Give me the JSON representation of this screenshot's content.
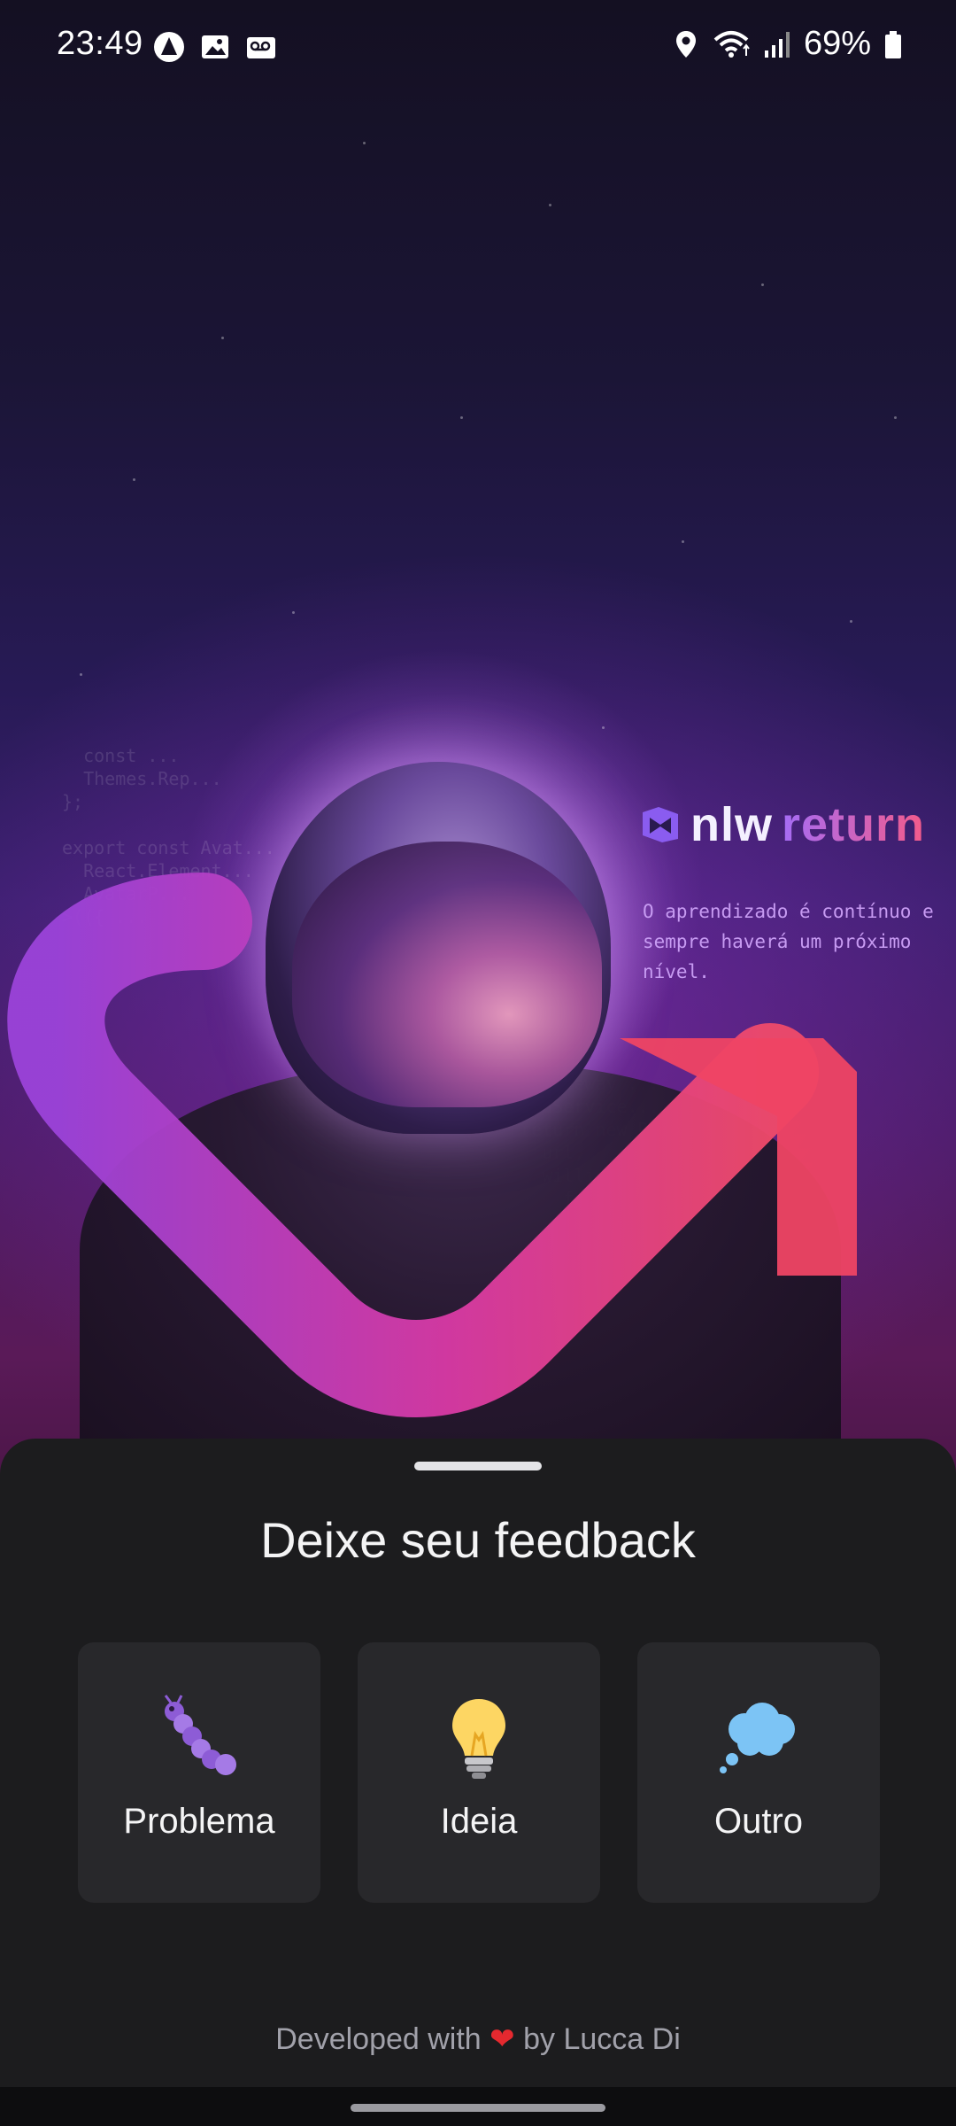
{
  "status_bar": {
    "time": "23:49",
    "left_icons": [
      "app-notification-icon",
      "image-icon",
      "voicemail-icon"
    ],
    "right_icons": [
      "location-icon",
      "wifi-icon",
      "signal-icon",
      "battery-icon"
    ],
    "battery_percent": "69%"
  },
  "hero": {
    "logo_nlw": "nlw",
    "logo_return": "return",
    "tagline": "O aprendizado é contínuo e sempre haverá um próximo nível."
  },
  "sheet": {
    "title": "Deixe seu feedback",
    "options": [
      {
        "label": "Problema",
        "icon": "bug-icon"
      },
      {
        "label": "Ideia",
        "icon": "lightbulb-icon"
      },
      {
        "label": "Outro",
        "icon": "thought-bubble-icon"
      }
    ],
    "footer_prefix": "Developed with",
    "footer_heart": "❤",
    "footer_suffix": "by Lucca Di"
  },
  "colors": {
    "sheet_bg": "#1c1c1e",
    "card_bg": "#28282b",
    "brand_purple": "#a56cf5",
    "brand_pink": "#f35b8a",
    "heart": "#e5292f"
  }
}
